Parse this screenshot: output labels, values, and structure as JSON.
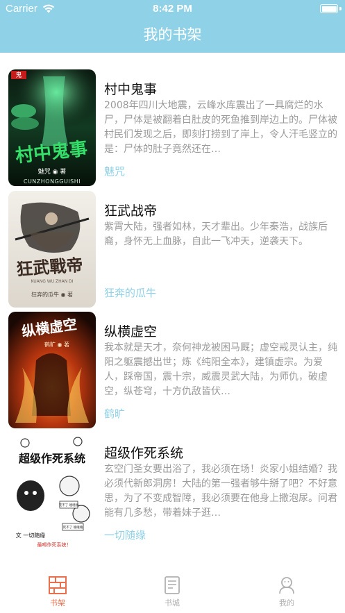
{
  "status_bar": {
    "carrier": "Carrier",
    "time": "8:42 PM"
  },
  "header": {
    "title": "我的书架"
  },
  "books": [
    {
      "title": "村中鬼事",
      "description": "2008年四川大地震，云峰水库震出了一具腐烂的水尸，尸体是被翻着白肚皮的死鱼推到岸边上的。尸体被村民们发现之后，即刻打捞到了岸上，令人汗毛竖立的是：尸体的肚子竟然还在…",
      "author": "魅咒",
      "cover_text": {
        "badge": "鬼",
        "main": "村中鬼事",
        "author": "魅咒 ◉ 著",
        "pinyin": "CUNZHONGGUISHI"
      }
    },
    {
      "title": "狂武战帝",
      "description": "紫霄大陆，强者如林，天才辈出。少年秦浩，战族后裔，身怀无上血脉，自此一飞冲天，逆袭天下。",
      "author": "狂奔的瓜牛",
      "cover_text": {
        "main": "狂武戰帝",
        "pinyin": "KUANG WU ZHAN DI",
        "author": "狂奔的瓜牛 ◉ 著"
      }
    },
    {
      "title": "纵横虚空",
      "description": "我本就是天才，奈何神龙被困马厩；虚空戒灵认主，纯阳之躯震撼出世；炼《纯阳全本》，建镇虚宗。为爱人，踩帝国，震十宗，威震灵武大陆，为师仇，破虚空，纵苍穹，十方仇敌皆伏…",
      "author": "鹤旷",
      "cover_text": {
        "main": "纵横虚空",
        "author": "鹤旷 ◉ 著"
      }
    },
    {
      "title": "超级作死系统",
      "description": "玄空门圣女要出浴了，我必须在场！炎家小姐结婚？我必须代新郎洞房！大陆的第一强者够牛掰了吧？不好意思，为了不变成智障，我必须要在他身上撒泡尿。问君能有几多愁，带着妹子逛…",
      "author": "一切随缘",
      "cover_text": {
        "main": "超级作死系统",
        "author": "文 一切随缘",
        "tagline": "最嘚作死系统！",
        "bubble1": "死不了 嘻嘻嘻",
        "bubble2": "死不了 嘻嘻嘻"
      }
    }
  ],
  "tabbar": {
    "items": [
      {
        "label": "书架",
        "icon": "bookshelf-icon",
        "active": true
      },
      {
        "label": "书城",
        "icon": "bookstore-icon",
        "active": false
      },
      {
        "label": "我的",
        "icon": "profile-icon",
        "active": false
      }
    ]
  },
  "colors": {
    "header_bg": "#8fd1e6",
    "accent_active": "#e8704f",
    "author_color": "#8fd1e6",
    "desc_color": "#9a9a9a"
  }
}
